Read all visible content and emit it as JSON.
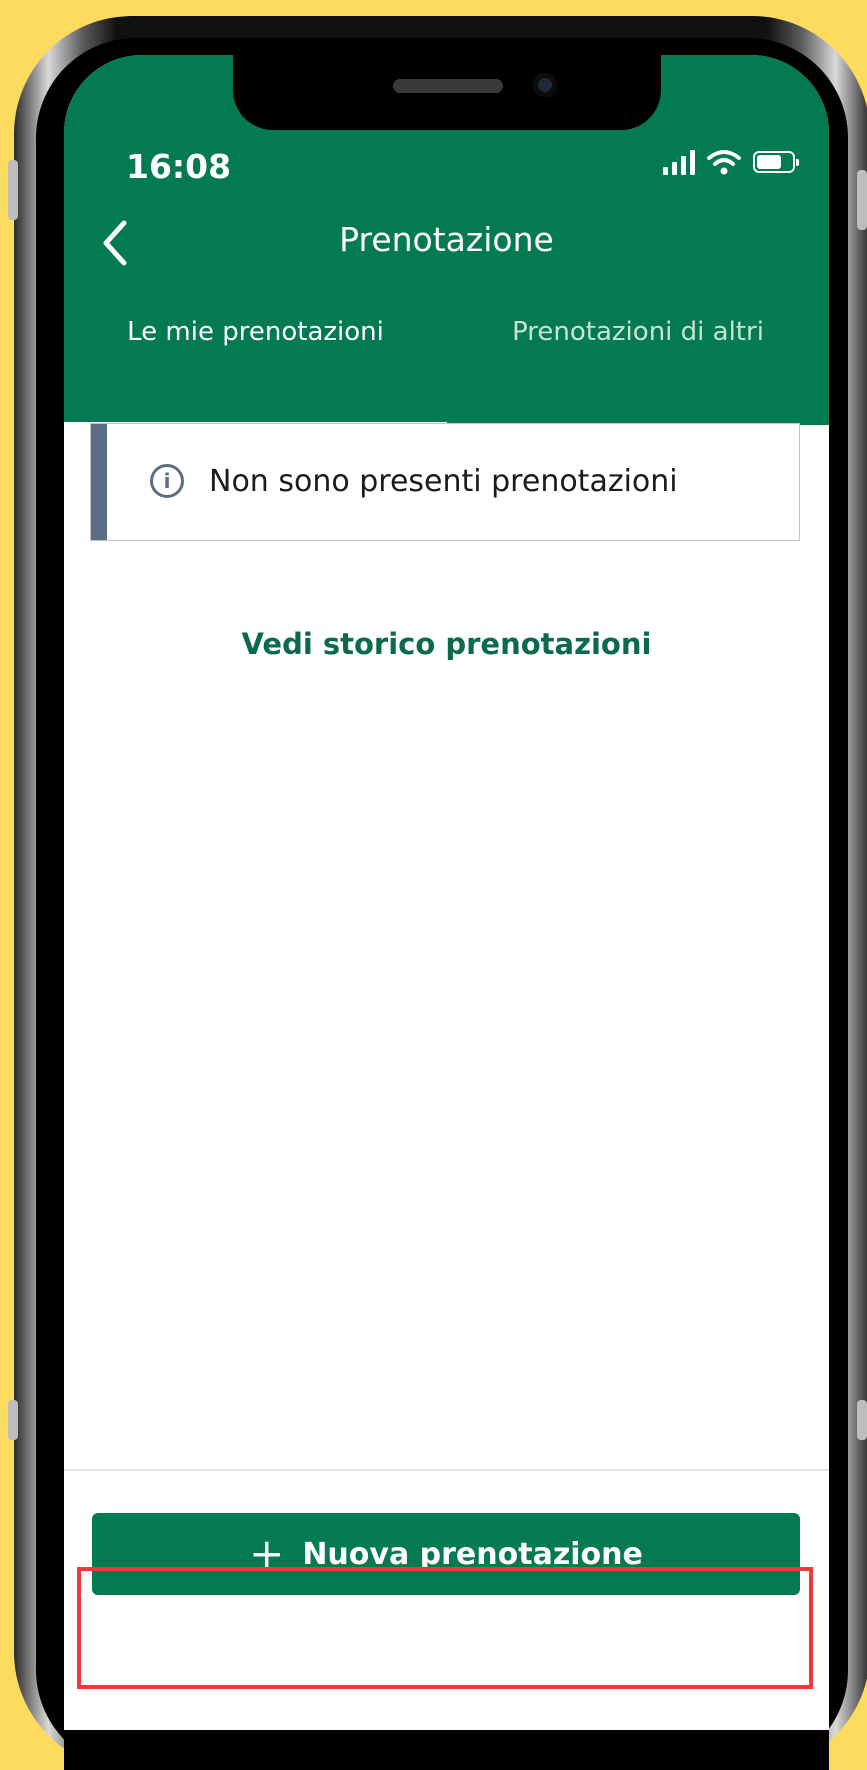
{
  "status_bar": {
    "time": "16:08"
  },
  "header": {
    "title": "Prenotazione",
    "back_icon": "chevron-left-icon"
  },
  "tabs": [
    {
      "label": "Le mie prenotazioni",
      "active": true
    },
    {
      "label": "Prenotazioni di altri",
      "active": false
    }
  ],
  "info": {
    "icon": "info-icon",
    "glyph": "i",
    "message": "Non sono presenti prenotazioni"
  },
  "history_link": "Vedi storico prenotazioni",
  "new_booking": {
    "icon_glyph": "+",
    "label": "Nuova prenotazione"
  },
  "colors": {
    "brand_green": "#047A51",
    "background": "#FCDB5E",
    "highlight": "#EE3A3A"
  }
}
